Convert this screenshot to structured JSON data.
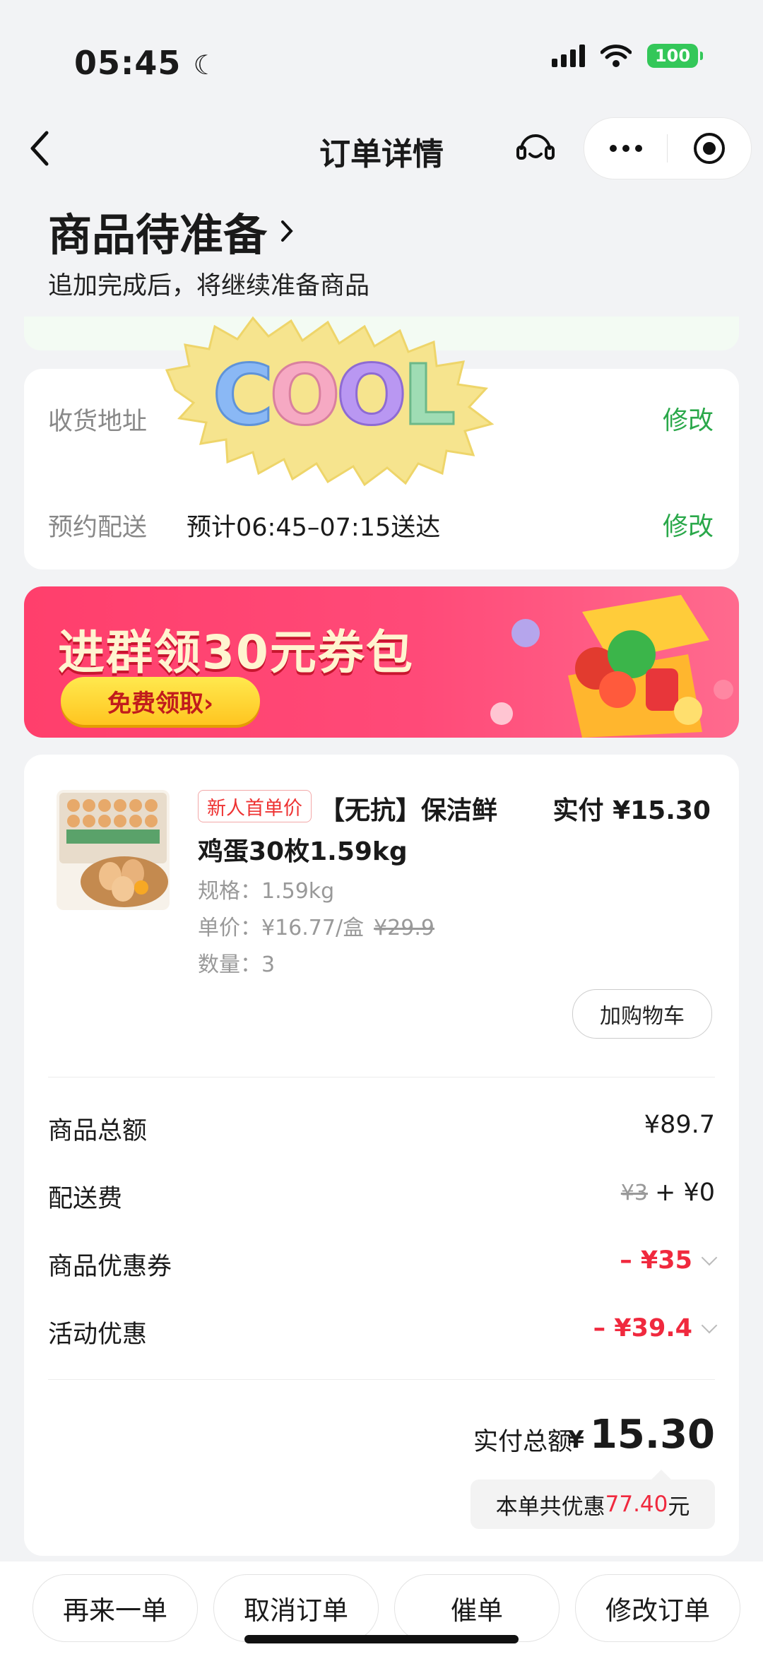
{
  "status_bar": {
    "time": "05:45",
    "battery": "100"
  },
  "nav": {
    "title": "订单详情"
  },
  "order_status": {
    "title": "商品待准备",
    "subtitle": "追加完成后，将继续准备商品"
  },
  "sticker_text": "COOL",
  "delivery": {
    "address_label": "收货地址",
    "schedule_label": "预约配送",
    "schedule_value": "预计06:45–07:15送达",
    "edit_label": "修改"
  },
  "banner": {
    "title": "进群领30元券包",
    "button": "免费领取›"
  },
  "product": {
    "tag": "新人首单价",
    "name_line1": "【无抗】保洁鲜",
    "name_line2": "鸡蛋30枚1.59kg",
    "paid": "实付 ¥15.30",
    "spec_label": "规格：",
    "spec_value": "1.59kg",
    "unit_label": "单价：",
    "unit_price": "¥16.77/盒",
    "original_price": "¥29.9",
    "qty_label": "数量：",
    "qty_value": "3",
    "add_cart": "加购物车"
  },
  "summary": {
    "goods_total_label": "商品总额",
    "goods_total": "¥89.7",
    "delivery_fee_label": "配送费",
    "delivery_fee_original": "¥3",
    "delivery_fee": "+ ¥0",
    "coupon_label": "商品优惠券",
    "coupon": "– ¥35",
    "promo_label": "活动优惠",
    "promo": "– ¥39.4",
    "paid_total_label": "实付总额",
    "currency": "¥",
    "paid_total": "15.30",
    "saving_prefix": "本单共优惠",
    "saving_amount": "77.40",
    "saving_suffix": "元"
  },
  "actions": [
    "再来一单",
    "取消订单",
    "催单",
    "修改订单"
  ],
  "colors": {
    "accent_green": "#2aa84a",
    "discount_red": "#f0293e",
    "banner_pink": "#ff4a78"
  }
}
